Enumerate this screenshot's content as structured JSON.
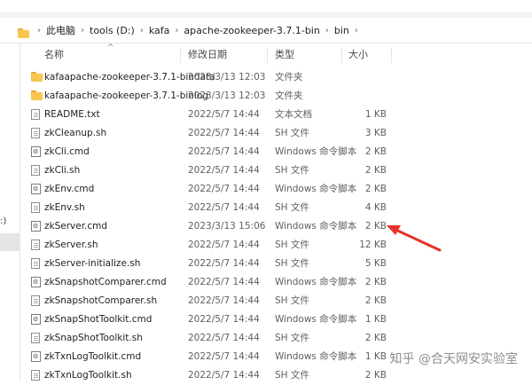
{
  "breadcrumb": {
    "items": [
      "此电脑",
      "tools (D:)",
      "kafa",
      "apache-zookeeper-3.7.1-bin",
      "bin"
    ]
  },
  "sidebar": {
    "fragment": ":)"
  },
  "columns": {
    "name": "名称",
    "date": "修改日期",
    "type": "类型",
    "size": "大小"
  },
  "files": [
    {
      "name": "kafaapache-zookeeper-3.7.1-bindata",
      "date": "2023/3/13 12:03",
      "type": "文件夹",
      "size": "",
      "icon": "folder-icon"
    },
    {
      "name": "kafaapache-zookeeper-3.7.1-binlog",
      "date": "2023/3/13 12:03",
      "type": "文件夹",
      "size": "",
      "icon": "folder-icon"
    },
    {
      "name": "README.txt",
      "date": "2022/5/7 14:44",
      "type": "文本文档",
      "size": "1 KB",
      "icon": "text-file-icon"
    },
    {
      "name": "zkCleanup.sh",
      "date": "2022/5/7 14:44",
      "type": "SH 文件",
      "size": "3 KB",
      "icon": "file-icon"
    },
    {
      "name": "zkCli.cmd",
      "date": "2022/5/7 14:44",
      "type": "Windows 命令脚本",
      "size": "2 KB",
      "icon": "script-icon"
    },
    {
      "name": "zkCli.sh",
      "date": "2022/5/7 14:44",
      "type": "SH 文件",
      "size": "2 KB",
      "icon": "file-icon"
    },
    {
      "name": "zkEnv.cmd",
      "date": "2022/5/7 14:44",
      "type": "Windows 命令脚本",
      "size": "2 KB",
      "icon": "script-icon"
    },
    {
      "name": "zkEnv.sh",
      "date": "2022/5/7 14:44",
      "type": "SH 文件",
      "size": "4 KB",
      "icon": "file-icon"
    },
    {
      "name": "zkServer.cmd",
      "date": "2023/3/13 15:06",
      "type": "Windows 命令脚本",
      "size": "2 KB",
      "icon": "script-icon"
    },
    {
      "name": "zkServer.sh",
      "date": "2022/5/7 14:44",
      "type": "SH 文件",
      "size": "12 KB",
      "icon": "file-icon"
    },
    {
      "name": "zkServer-initialize.sh",
      "date": "2022/5/7 14:44",
      "type": "SH 文件",
      "size": "5 KB",
      "icon": "file-icon"
    },
    {
      "name": "zkSnapshotComparer.cmd",
      "date": "2022/5/7 14:44",
      "type": "Windows 命令脚本",
      "size": "2 KB",
      "icon": "script-icon"
    },
    {
      "name": "zkSnapshotComparer.sh",
      "date": "2022/5/7 14:44",
      "type": "SH 文件",
      "size": "2 KB",
      "icon": "file-icon"
    },
    {
      "name": "zkSnapShotToolkit.cmd",
      "date": "2022/5/7 14:44",
      "type": "Windows 命令脚本",
      "size": "1 KB",
      "icon": "script-icon"
    },
    {
      "name": "zkSnapShotToolkit.sh",
      "date": "2022/5/7 14:44",
      "type": "SH 文件",
      "size": "2 KB",
      "icon": "file-icon"
    },
    {
      "name": "zkTxnLogToolkit.cmd",
      "date": "2022/5/7 14:44",
      "type": "Windows 命令脚本",
      "size": "1 KB",
      "icon": "script-icon"
    },
    {
      "name": "zkTxnLogToolkit.sh",
      "date": "2022/5/7 14:44",
      "type": "SH 文件",
      "size": "2 KB",
      "icon": "file-icon"
    }
  ],
  "annotation": {
    "color": "#e8312a",
    "icon": "red-arrow-icon"
  },
  "watermark": {
    "text": "知乎 @合天网安实验室"
  }
}
